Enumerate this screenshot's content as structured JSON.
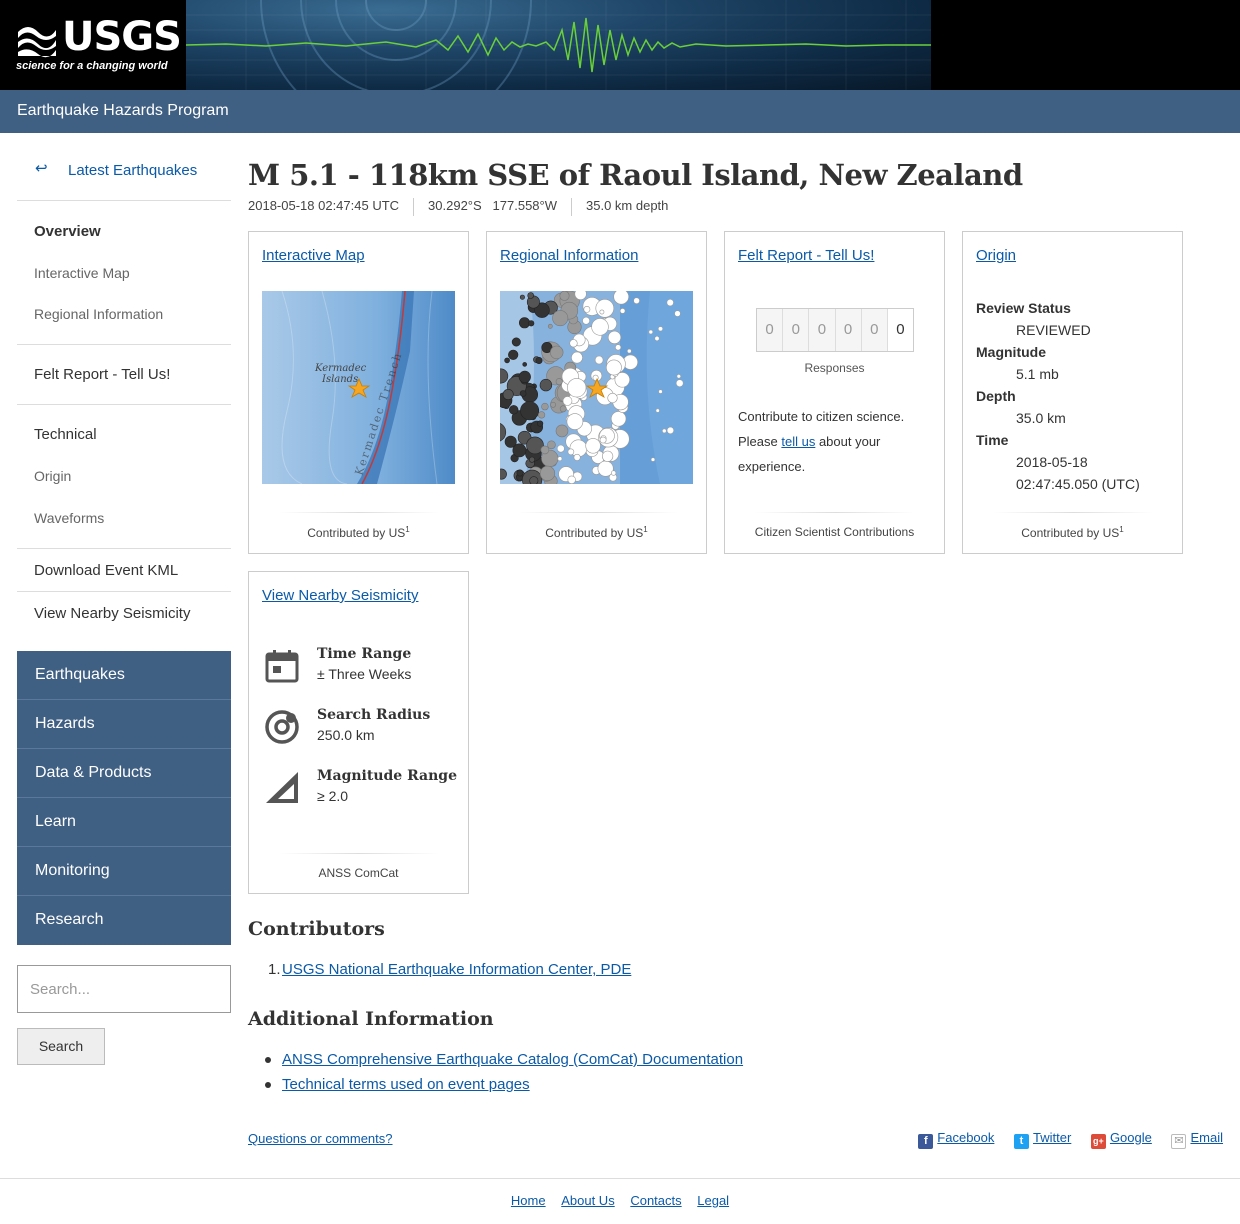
{
  "header": {
    "logo_text": "USGS",
    "logo_tagline": "science for a changing world",
    "program_title": "Earthquake Hazards Program"
  },
  "sidebar": {
    "latest": "Latest Earthquakes",
    "overview": "Overview",
    "interactive_map": "Interactive Map",
    "regional_information": "Regional Information",
    "felt_report": "Felt Report - Tell Us!",
    "technical": "Technical",
    "origin": "Origin",
    "waveforms": "Waveforms",
    "download_kml": "Download Event KML",
    "view_nearby": "View Nearby Seismicity",
    "nav": [
      "Earthquakes",
      "Hazards",
      "Data & Products",
      "Learn",
      "Monitoring",
      "Research"
    ],
    "search_placeholder": "Search...",
    "search_button": "Search"
  },
  "event": {
    "title": "M 5.1 - 118km SSE of Raoul Island, New Zealand",
    "time": "2018-05-18 02:47:45 UTC",
    "lat": "30.292°S",
    "lon": "177.558°W",
    "depth": "35.0 km depth"
  },
  "cards": {
    "map": {
      "title": "Interactive Map",
      "contrib": "Contributed by US",
      "sup": "1",
      "map_label1": "Kermadec",
      "map_label2": "Islands",
      "map_label3": "Kermadec Trench"
    },
    "regional": {
      "title": "Regional Information",
      "contrib": "Contributed by US",
      "sup": "1"
    },
    "felt": {
      "title": "Felt Report - Tell Us!",
      "digits": [
        "0",
        "0",
        "0",
        "0",
        "0",
        "0"
      ],
      "responses": "Responses",
      "text1": "Contribute to citizen science.",
      "text2": "Please ",
      "link": "tell us",
      "text3": " about your experience.",
      "foot": "Citizen Scientist Contributions"
    },
    "origin": {
      "title": "Origin",
      "review_label": "Review Status",
      "review_value": "REVIEWED",
      "mag_label": "Magnitude",
      "mag_value": "5.1 mb",
      "depth_label": "Depth",
      "depth_value": "35.0 km",
      "time_label": "Time",
      "time_value1": "2018-05-18",
      "time_value2": "02:47:45.050 (UTC)",
      "contrib": "Contributed by US",
      "sup": "1"
    },
    "nearby": {
      "title": "View Nearby Seismicity",
      "time_label": "Time Range",
      "time_value": "± Three Weeks",
      "radius_label": "Search Radius",
      "radius_value": "250.0 km",
      "mag_label": "Magnitude Range",
      "mag_value": "≥ 2.0",
      "foot": "ANSS ComCat"
    }
  },
  "contributors": {
    "heading": "Contributors",
    "items": [
      "USGS National Earthquake Information Center, PDE"
    ]
  },
  "additional": {
    "heading": "Additional Information",
    "items": [
      "ANSS Comprehensive Earthquake Catalog (ComCat) Documentation",
      "Technical terms used on event pages"
    ]
  },
  "feedback": {
    "questions": "Questions or comments?",
    "facebook": "Facebook",
    "twitter": "Twitter",
    "google": "Google",
    "email": "Email"
  },
  "footer": [
    "Home",
    "About Us",
    "Contacts",
    "Legal"
  ],
  "colors": {
    "nav_blue": "#3f5f83",
    "link": "#0b5aa8"
  }
}
